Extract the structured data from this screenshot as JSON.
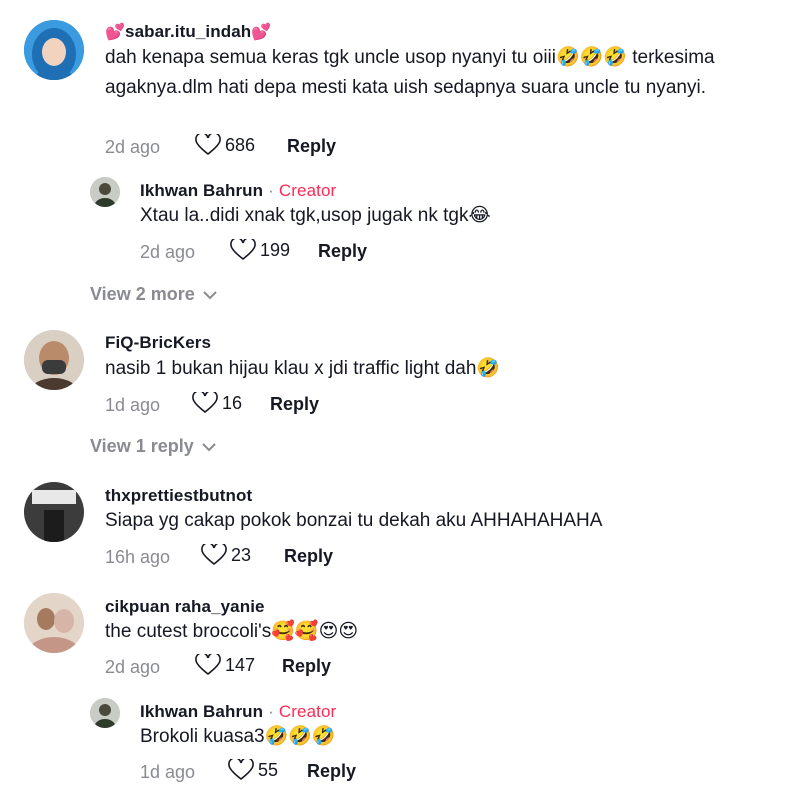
{
  "comments": [
    {
      "username": "sabar.itu_indah",
      "username_prefix": "💕",
      "username_suffix": "💕",
      "text": "dah kenapa semua keras tgk uncle usop nyanyi tu oiii🤣🤣🤣 terkesima agaknya.dlm hati depa mesti kata uish sedapnya suara uncle tu nyanyi.",
      "time": "2d ago",
      "likes": "686",
      "reply_label": "Reply"
    },
    {
      "username": "Ikhwan Bahrun",
      "dot": "·",
      "badge": "Creator",
      "text": "Xtau la..didi xnak tgk,usop jugak nk tgk😂",
      "time": "2d ago",
      "likes": "199",
      "reply_label": "Reply"
    },
    {
      "view_more": "View 2 more"
    },
    {
      "username": "FiQ-BricKers",
      "text": "nasib 1 bukan hijau klau x jdi traffic light dah🤣",
      "time": "1d ago",
      "likes": "16",
      "reply_label": "Reply"
    },
    {
      "view_more": "View 1 reply"
    },
    {
      "username": "thxprettiestbutnot",
      "text": "Siapa yg cakap pokok bonzai tu dekah aku AHHAHAHAHA",
      "time": "16h ago",
      "likes": "23",
      "reply_label": "Reply"
    },
    {
      "username": "cikpuan raha_yanie",
      "text": "the cutest broccoli's🥰🥰😍😍",
      "time": "2d ago",
      "likes": "147",
      "reply_label": "Reply"
    },
    {
      "username": "Ikhwan Bahrun",
      "dot": "·",
      "badge": "Creator",
      "text": "Brokoli kuasa3🤣🤣🤣",
      "time": "1d ago",
      "likes": "55",
      "reply_label": "Reply"
    }
  ],
  "colors": {
    "creator": "#fe2c55",
    "muted": "#8a8b91",
    "text": "#161823"
  },
  "icons": {
    "like": "heart-outline-icon",
    "expand": "chevron-down-icon"
  }
}
